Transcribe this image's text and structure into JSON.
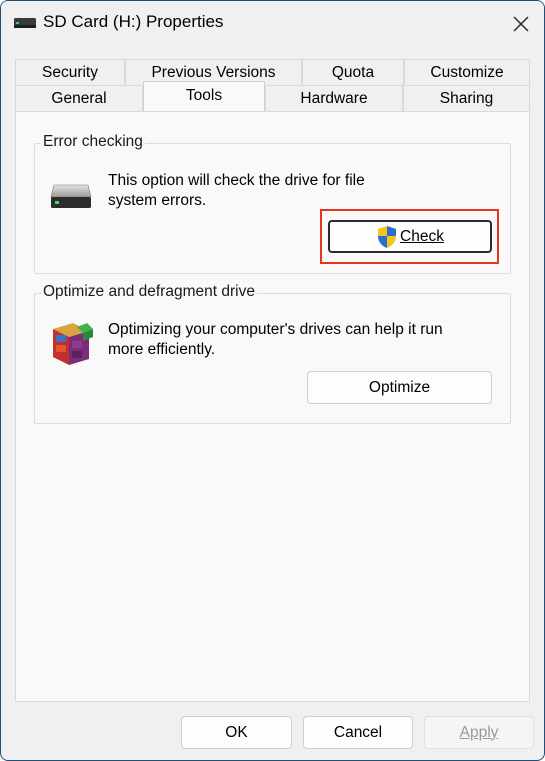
{
  "window": {
    "title": "SD Card (H:) Properties"
  },
  "tabs": {
    "row1": [
      {
        "label": "Security"
      },
      {
        "label": "Previous Versions"
      },
      {
        "label": "Quota"
      },
      {
        "label": "Customize"
      }
    ],
    "row2": [
      {
        "label": "General"
      },
      {
        "label": "Tools",
        "selected": true
      },
      {
        "label": "Hardware"
      },
      {
        "label": "Sharing"
      }
    ]
  },
  "error_checking": {
    "group_label": "Error checking",
    "description_line1": "This option will check the drive for file",
    "description_line2": "system errors.",
    "button_label": "Check"
  },
  "optimize": {
    "group_label": "Optimize and defragment drive",
    "description_line1": "Optimizing your computer's drives can help it run",
    "description_line2": "more efficiently.",
    "button_label": "Optimize"
  },
  "footer": {
    "ok_label": "OK",
    "cancel_label": "Cancel",
    "apply_label": "Apply"
  },
  "colors": {
    "highlight": "#e8341c",
    "shield_blue": "#2b6fd6",
    "shield_yellow": "#f5c518"
  }
}
